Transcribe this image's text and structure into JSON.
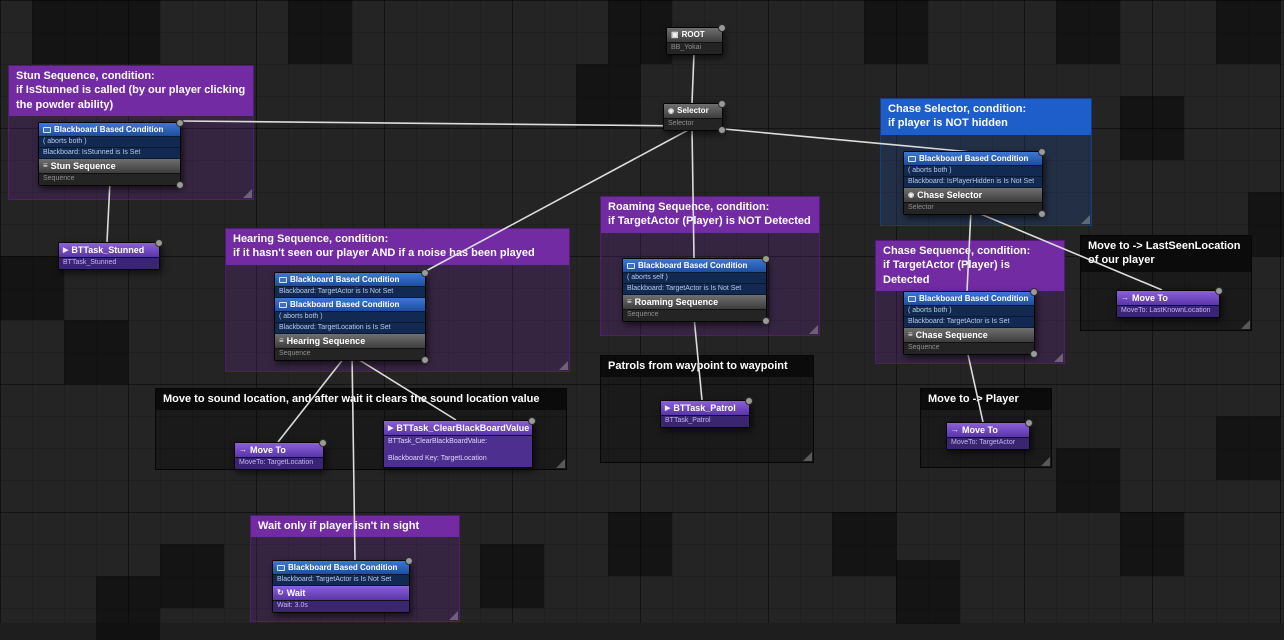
{
  "colors": {
    "comment_purple": "#722ba3",
    "comment_blue": "#1d5ecb",
    "comment_black": "#0b0b0b",
    "decorator_blue": "#2e63b8",
    "task_purple": "#6b44be",
    "wire": "#dcdcdc"
  },
  "comments": {
    "stun": "Stun Sequence, condition:\nif IsStunned is called (by our player clicking\nthe powder ability)",
    "hearing": "Hearing Sequence, condition:\nif it hasn't seen our player AND if a noise has been played",
    "move_sound": "Move to sound location, and after wait it clears the sound location value",
    "wait": "Wait only if player isn't in sight",
    "roaming": "Roaming Sequence, condition:\nif TargetActor (Player) is NOT Detected",
    "patrol": "Patrols from waypoint to waypoint",
    "chase_selector": "Chase Selector, condition:\nif player is NOT hidden",
    "chase_sequence": "Chase Sequence, condition:\nif TargetActor (Player) is Detected",
    "lastseen": "Move to -> LastSeenLocation\nof our player",
    "player": "Move to -> Player"
  },
  "nodes": {
    "root": {
      "title": "ROOT",
      "subtitle": "BB_Yokai"
    },
    "selector": {
      "title": "Selector",
      "subtitle": "Selector"
    },
    "stun": {
      "dec1_title": "Blackboard Based Condition",
      "dec1_line1": "( aborts both )",
      "dec1_line2": "Blackboard: IsStunned is Is Set",
      "title": "Stun Sequence",
      "subtitle": "Sequence"
    },
    "stunned_task": {
      "title": "BTTask_Stunned",
      "subtitle": "BTTask_Stunned"
    },
    "hearing": {
      "dec1_title": "Blackboard Based Condition",
      "dec1_line1": "Blackboard: TargetActor is Is Not Set",
      "dec2_title": "Blackboard Based Condition",
      "dec2_line1": "( aborts both )",
      "dec2_line2": "Blackboard: TargetLocation is Is Set",
      "title": "Hearing Sequence",
      "subtitle": "Sequence"
    },
    "move_sound": {
      "title": "Move To",
      "subtitle": "MoveTo: TargetLocation"
    },
    "clear_bb": {
      "title": "BTTask_ClearBlackBoardValue",
      "line1": "BTTask_ClearBlackBoardValue:",
      "line2": "Blackboard Key: TargetLocation"
    },
    "wait": {
      "dec1_title": "Blackboard Based Condition",
      "dec1_line1": "Blackboard: TargetActor is Is Not Set",
      "title": "Wait",
      "subtitle": "Wait: 3.0s"
    },
    "roaming": {
      "dec1_title": "Blackboard Based Condition",
      "dec1_line1": "( aborts self )",
      "dec1_line2": "Blackboard: TargetActor is Is Not Set",
      "title": "Roaming Sequence",
      "subtitle": "Sequence"
    },
    "patrol_task": {
      "title": "BTTask_Patrol",
      "subtitle": "BTTask_Patrol"
    },
    "chase_selector": {
      "dec1_title": "Blackboard Based Condition",
      "dec1_line1": "( aborts both )",
      "dec1_line2": "Blackboard: IsPlayerHidden is Is Not Set",
      "title": "Chase Selector",
      "subtitle": "Selector"
    },
    "chase_sequence": {
      "dec1_title": "Blackboard Based Condition",
      "dec1_line1": "( aborts both )",
      "dec1_line2": "Blackboard: TargetActor is Is Set",
      "title": "Chase Sequence",
      "subtitle": "Sequence"
    },
    "move_lastseen": {
      "title": "Move To",
      "subtitle": "MoveTo: LastKnownLocation"
    },
    "move_player": {
      "title": "Move To",
      "subtitle": "MoveTo: TargetActor"
    }
  }
}
